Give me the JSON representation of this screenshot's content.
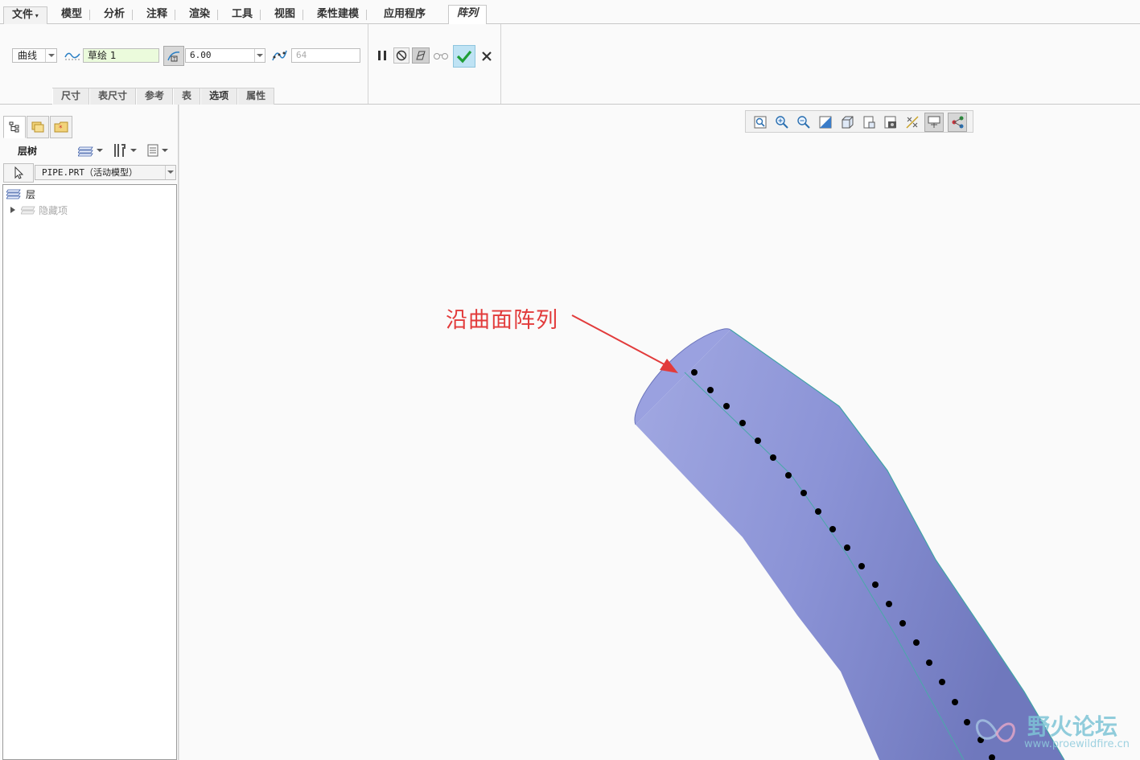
{
  "menu": {
    "file": "文件",
    "tabs": [
      "模型",
      "分析",
      "注释",
      "渲染",
      "工具",
      "视图",
      "柔性建模",
      "应用程序"
    ],
    "active_tab": "阵列"
  },
  "ribbon": {
    "pattern_type": "曲线",
    "sketch_value": "草绘 1",
    "spacing_value": "6.00",
    "count_value": "64",
    "subtabs": [
      "尺寸",
      "表尺寸",
      "参考",
      "表",
      "选项",
      "属性"
    ]
  },
  "left_panel": {
    "title": "层树",
    "model_selector": "PIPE.PRT（活动模型）",
    "tree": {
      "root": "层",
      "child": "隐藏项"
    }
  },
  "viewport": {
    "annotation": "沿曲面阵列",
    "annotation_color": "#e23b3b",
    "pipe_color": "#8b93d6"
  },
  "watermark": {
    "title": "野火论坛",
    "url": "www.proewildfire.cn"
  },
  "icons": {
    "view_toolbar": [
      "refit-icon",
      "zoom-in-icon",
      "zoom-out-icon",
      "repaint-icon",
      "display-style-icon",
      "saved-views-icon",
      "view-manager-icon",
      "perspective-icon",
      "datum-display-icon",
      "annotation-display-icon",
      "spin-center-icon"
    ]
  }
}
